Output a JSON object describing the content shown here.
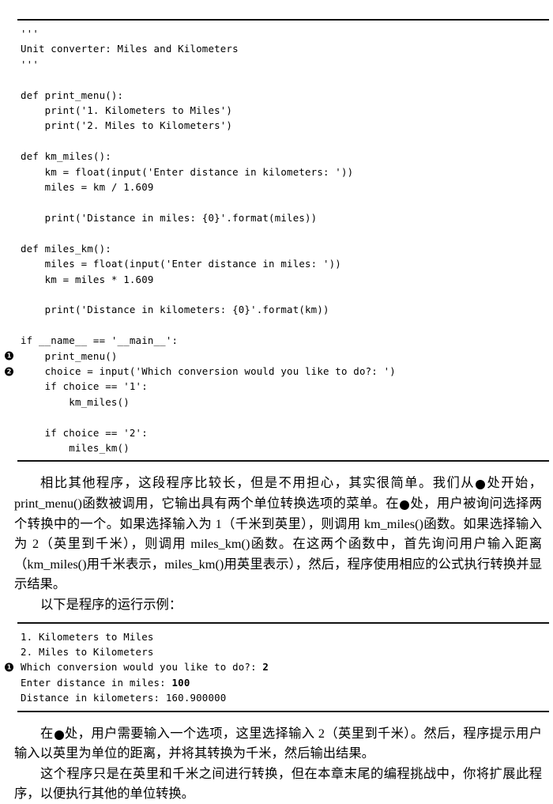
{
  "listing_main": {
    "name": "unit-converter-source-listing",
    "lines": [
      {
        "text": "'''"
      },
      {
        "text": "Unit converter: Miles and Kilometers"
      },
      {
        "text": "'''"
      },
      {
        "text": ""
      },
      {
        "text": "def print_menu():"
      },
      {
        "text": "    print('1. Kilometers to Miles')"
      },
      {
        "text": "    print('2. Miles to Kilometers')"
      },
      {
        "text": ""
      },
      {
        "text": "def km_miles():"
      },
      {
        "text": "    km = float(input('Enter distance in kilometers: '))"
      },
      {
        "text": "    miles = km / 1.609"
      },
      {
        "text": ""
      },
      {
        "text": "    print('Distance in miles: {0}'.format(miles))"
      },
      {
        "text": ""
      },
      {
        "text": "def miles_km():"
      },
      {
        "text": "    miles = float(input('Enter distance in miles: '))"
      },
      {
        "text": "    km = miles * 1.609"
      },
      {
        "text": ""
      },
      {
        "text": "    print('Distance in kilometers: {0}'.format(km))"
      },
      {
        "text": ""
      },
      {
        "text": "if __name__ == '__main__':"
      },
      {
        "text": "    print_menu()",
        "callout": "❶"
      },
      {
        "text": "    choice = input('Which conversion would you like to do?: ')",
        "callout": "❷"
      },
      {
        "text": "    if choice == '1':"
      },
      {
        "text": "        km_miles()"
      },
      {
        "text": ""
      },
      {
        "text": "    if choice == '2':"
      },
      {
        "text": "        miles_km()"
      }
    ]
  },
  "para_1": {
    "name": "explanation-paragraph-1",
    "segments": [
      {
        "type": "text",
        "value": "相比其他程序，这段程序比较长，但是不用担心，其实很简单。我们从"
      },
      {
        "type": "callout",
        "value": "❶"
      },
      {
        "type": "text",
        "value": "处开始，print_menu()函数被调用，它输出具有两个单位转换选项的菜单。在"
      },
      {
        "type": "callout",
        "value": "❷"
      },
      {
        "type": "text",
        "value": "处，用户被询问选择两个转换中的一个。如果选择输入为 1（千米到英里），则调用 km_miles()函数。如果选择输入为 2（英里到千米），则调用 miles_km()函数。在这两个函数中，首先询问用户输入距离（km_miles()用千米表示，miles_km()用英里表示），然后，程序使用相应的公式执行转换并显示结果。"
      }
    ]
  },
  "para_2": {
    "name": "run-example-lead-in",
    "text": "以下是程序的运行示例："
  },
  "listing_output": {
    "name": "program-output-listing",
    "lines": [
      {
        "text": "1. Kilometers to Miles"
      },
      {
        "text": "2. Miles to Kilometers"
      },
      {
        "text": "Which conversion would you like to do?: ",
        "bold_suffix": "2",
        "callout": "❶"
      },
      {
        "text": "Enter distance in miles: ",
        "bold_suffix": "100"
      },
      {
        "text": "Distance in kilometers: 160.900000"
      }
    ]
  },
  "para_3": {
    "name": "explanation-paragraph-2",
    "segments": [
      {
        "type": "text",
        "value": "在"
      },
      {
        "type": "callout",
        "value": "❶"
      },
      {
        "type": "text",
        "value": "处，用户需要输入一个选项，这里选择输入 2（英里到千米）。然后，程序提示用户输入以英里为单位的距离，并将其转换为千米，然后输出结果。"
      }
    ]
  },
  "para_4": {
    "name": "explanation-paragraph-3",
    "text": "这个程序只是在英里和千米之间进行转换，但在本章末尾的编程挑战中，你将扩展此程序，以便执行其他的单位转换。"
  }
}
